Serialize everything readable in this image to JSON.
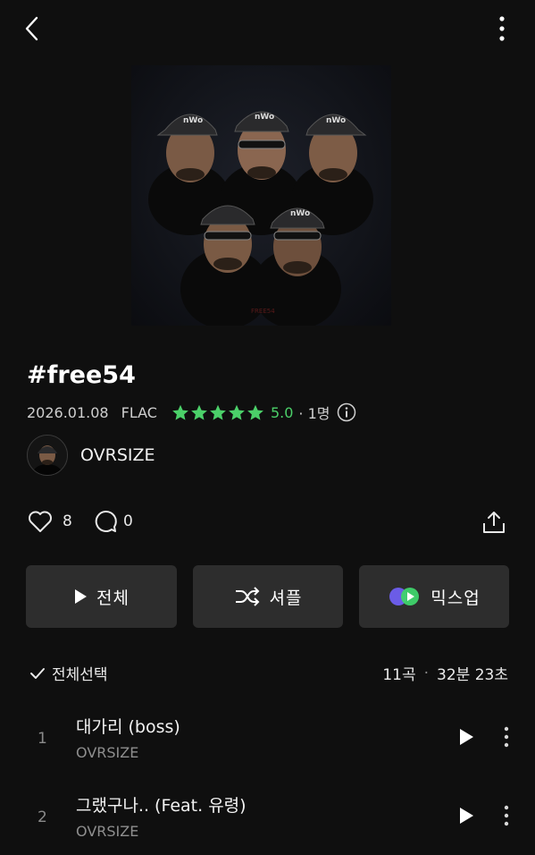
{
  "header": {
    "back_icon": "chevron-left-icon",
    "more_icon": "more-vertical-icon"
  },
  "album": {
    "title": "#free54",
    "date": "2026.01.08",
    "format": "FLAC",
    "rating": "5.0",
    "rating_count": "· 1명",
    "stars": 5,
    "cover_text": "FREE54"
  },
  "artist": {
    "name": "OVRSIZE"
  },
  "stats": {
    "likes": "8",
    "comments": "0"
  },
  "buttons": {
    "play_all": "전체",
    "shuffle": "셔플",
    "mixup": "믹스업"
  },
  "list_header": {
    "select_all": "전체선택",
    "track_count": "11곡",
    "duration": "32분 23초"
  },
  "tracks": [
    {
      "number": "1",
      "title": "대가리 (boss)",
      "artist": "OVRSIZE"
    },
    {
      "number": "2",
      "title": "그랬구나.. (Feat. 유령)",
      "artist": "OVRSIZE"
    }
  ],
  "colors": {
    "background": "#0f0f0f",
    "accent_green": "#4bd069",
    "button_bg": "#2d2d2d"
  }
}
